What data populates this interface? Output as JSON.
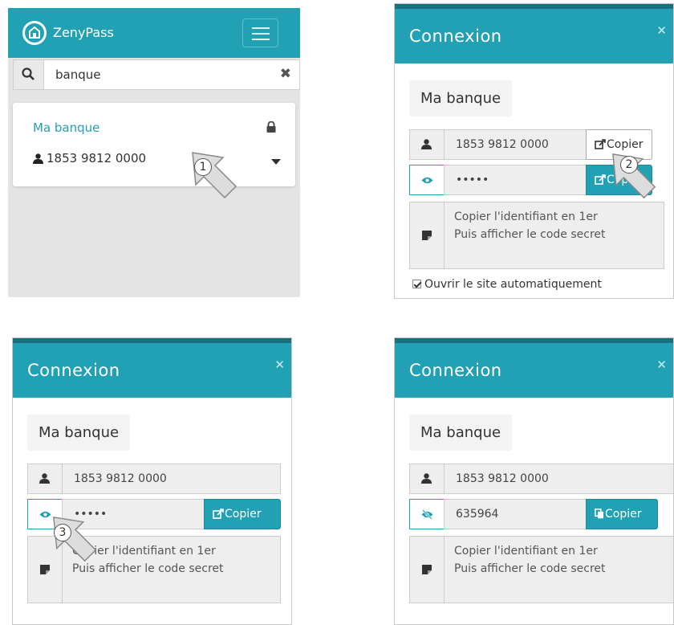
{
  "app": {
    "brand": "ZenyPass",
    "search": {
      "value": "banque"
    },
    "entry": {
      "title": "Ma banque",
      "login": "1853 9812 0000"
    }
  },
  "modals": [
    {
      "title": "Connexion",
      "site": "Ma banque",
      "login": "1853 9812 0000",
      "password": "•••••",
      "copy_label": "Copier",
      "note": "Copier l'identifiant en 1er\nPuis afficher le code secret",
      "auto_open": "Ouvrir le site automatiquement"
    },
    {
      "title": "Connexion",
      "site": "Ma banque",
      "login": "1853 9812 0000",
      "password": "•••••",
      "copy_label": "Copier",
      "note": "Copier l'identifiant en 1er\nPuis afficher le code secret"
    },
    {
      "title": "Connexion",
      "site": "Ma banque",
      "login": "1853 9812 0000",
      "password": "635964",
      "copy_label": "Copier",
      "note": "Copier l'identifiant en 1er\nPuis afficher le code secret"
    }
  ],
  "steps": [
    "1",
    "2",
    "3"
  ],
  "colors": {
    "accent": "#22a1b4",
    "accent_dark": "#196f7c"
  }
}
